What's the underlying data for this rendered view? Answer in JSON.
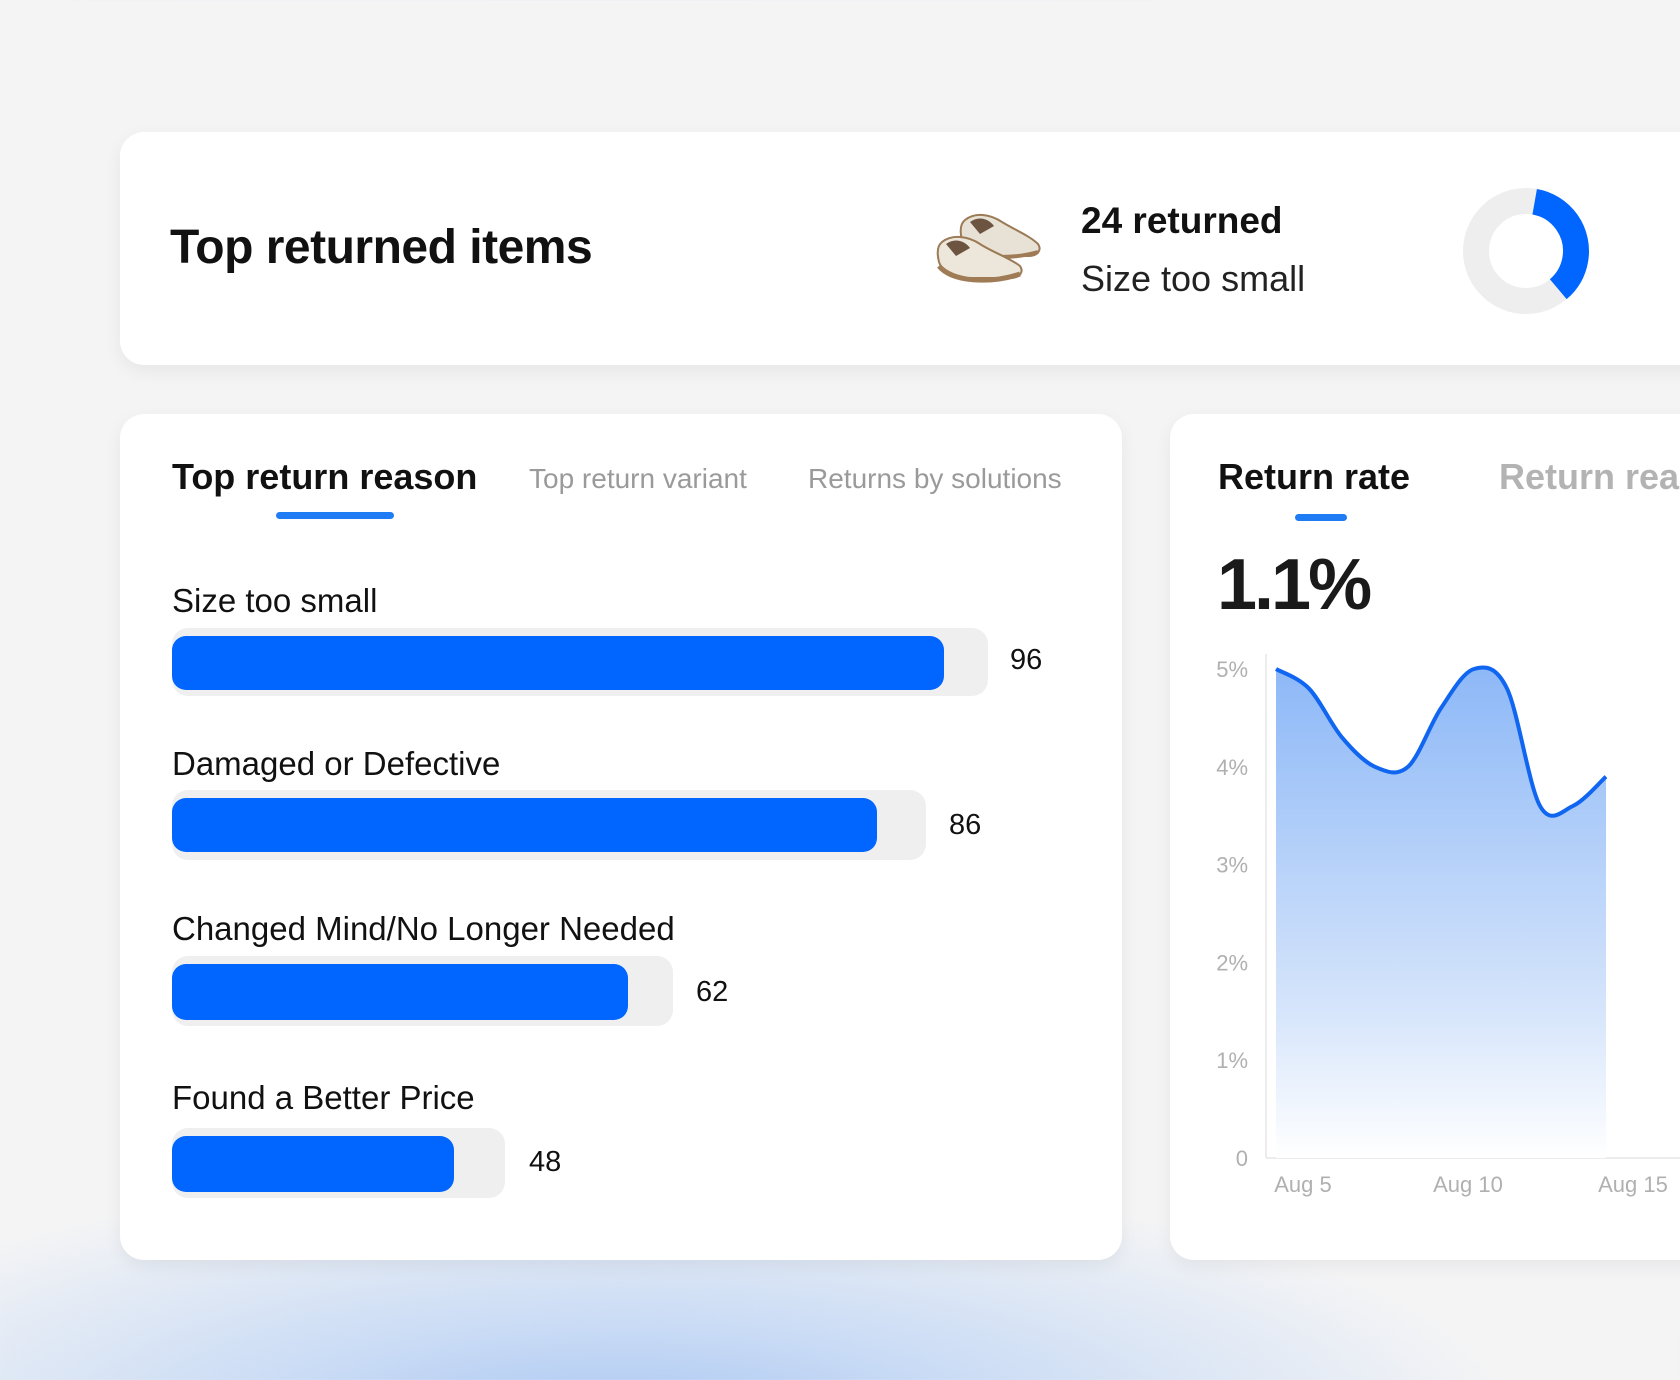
{
  "top_returned": {
    "title": "Top returned items",
    "item_count": "24 returned",
    "item_reason": "Size too small",
    "item_icon": "shoe-image",
    "donut_share": 0.36,
    "accent_color": "#0066ff"
  },
  "reasons_panel": {
    "tabs": [
      {
        "label": "Top return reason",
        "active": true
      },
      {
        "label": "Top return variant",
        "active": false
      },
      {
        "label": "Returns by solutions",
        "active": false
      }
    ],
    "items": [
      {
        "label": "Size too small",
        "value": "96"
      },
      {
        "label": "Damaged or Defective",
        "value": "86"
      },
      {
        "label": "Changed Mind/No Longer Needed",
        "value": "62"
      },
      {
        "label": "Found a Better Price",
        "value": "48"
      }
    ]
  },
  "rate_panel": {
    "tabs": [
      {
        "label": "Return rate",
        "active": true
      },
      {
        "label": "Return rea",
        "active": false
      }
    ],
    "current_rate": "1.1%"
  },
  "chart_data": {
    "type": "area",
    "title": "",
    "xlabel": "",
    "ylabel": "",
    "y_ticks": [
      "0",
      "1%",
      "2%",
      "3%",
      "4%",
      "5%"
    ],
    "x_ticks": [
      "Aug 5",
      "Aug 10",
      "Aug 15"
    ],
    "ylim": [
      0,
      5
    ],
    "x": [
      "Aug 5",
      "Aug 6",
      "Aug 7",
      "Aug 8",
      "Aug 9",
      "Aug 10",
      "Aug 11",
      "Aug 12",
      "Aug 13",
      "Aug 14",
      "Aug 15"
    ],
    "series": [
      {
        "values": [
          5.0,
          4.8,
          4.3,
          4.0,
          4.0,
          4.6,
          5.0,
          4.8,
          3.6,
          3.6,
          3.9
        ]
      }
    ],
    "grid": false,
    "line_color": "#1066f0"
  }
}
